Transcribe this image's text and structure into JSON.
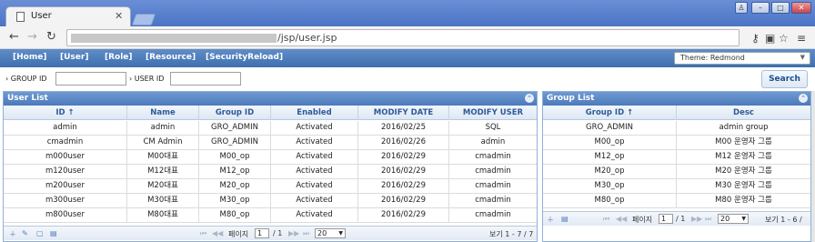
{
  "browser": {
    "tab_title": "User",
    "url_visible": "/jsp/user.jsp"
  },
  "menu": {
    "items": [
      "[Home]",
      "[User]",
      "[Role]",
      "[Resource]",
      "[SecurityReload]"
    ],
    "theme_label": "Theme: Redmond"
  },
  "search": {
    "group_label": "› GROUP ID",
    "user_label": "› USER ID",
    "group_value": "",
    "user_value": "",
    "button": "Search"
  },
  "user_list": {
    "title": "User List",
    "columns": [
      "ID ↑",
      "Name",
      "Group ID",
      "Enabled",
      "MODIFY DATE",
      "MODIFY USER"
    ],
    "rows": [
      [
        "admin",
        "admin",
        "GRO_ADMIN",
        "Activated",
        "2016/02/25",
        "SQL"
      ],
      [
        "cmadmin",
        "CM Admin",
        "GRO_ADMIN",
        "Activated",
        "2016/02/26",
        "admin"
      ],
      [
        "m000user",
        "M00대표",
        "M00_op",
        "Activated",
        "2016/02/29",
        "cmadmin"
      ],
      [
        "m120user",
        "M12대표",
        "M12_op",
        "Activated",
        "2016/02/29",
        "cmadmin"
      ],
      [
        "m200user",
        "M20대표",
        "M20_op",
        "Activated",
        "2016/02/29",
        "cmadmin"
      ],
      [
        "m300user",
        "M30대표",
        "M30_op",
        "Activated",
        "2016/02/29",
        "cmadmin"
      ],
      [
        "m800user",
        "M80대표",
        "M80_op",
        "Activated",
        "2016/02/29",
        "cmadmin"
      ]
    ],
    "pager": {
      "page_label": "페이지",
      "page": "1",
      "total_pages": "/ 1",
      "page_size": "20",
      "summary": "보기 1 - 7 / 7"
    }
  },
  "group_list": {
    "title": "Group List",
    "columns": [
      "Group ID ↑",
      "Desc"
    ],
    "rows": [
      [
        "GRO_ADMIN",
        "admin group"
      ],
      [
        "M00_op",
        "M00 운영자 그룹"
      ],
      [
        "M12_op",
        "M12 운영자 그룹"
      ],
      [
        "M20_op",
        "M20 운영자 그룹"
      ],
      [
        "M30_op",
        "M30 운영자 그룹"
      ],
      [
        "M80_op",
        "M80 운영자 그룹"
      ]
    ],
    "pager": {
      "page_label": "페이지",
      "page": "1",
      "total_pages": "/ 1",
      "page_size": "20",
      "summary": "보기 1 - 6 /"
    }
  },
  "colors": {
    "menubar": "#4f7cba",
    "panel_header": "#5e89c6",
    "grid_header_text": "#2e5b99"
  }
}
